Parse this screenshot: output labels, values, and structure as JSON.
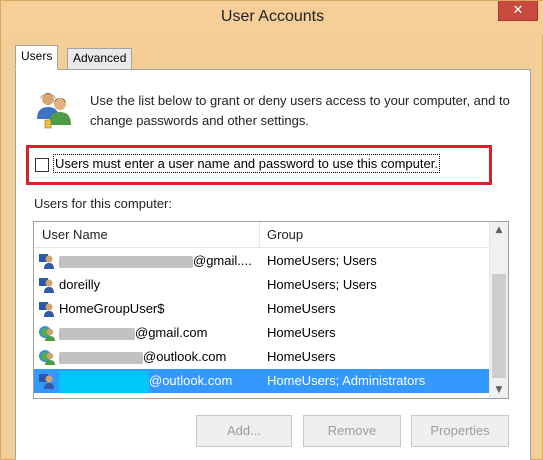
{
  "window": {
    "title": "User Accounts",
    "close_glyph": "✕"
  },
  "tabs": [
    {
      "label": "Users"
    },
    {
      "label": "Advanced"
    }
  ],
  "description": "Use the list below to grant or deny users access to your computer, and to change passwords and other settings.",
  "checkbox": {
    "label": "Users must enter a user name and password to use this computer.",
    "checked": false
  },
  "list": {
    "label": "Users for this computer:",
    "columns": [
      "User Name",
      "Group"
    ],
    "rows": [
      {
        "name_visible": "@gmail....",
        "group": "HomeUsers; Users",
        "icon": "local-user-icon",
        "redacted": true,
        "selected": false
      },
      {
        "name_visible": "doreilly",
        "group": "HomeUsers; Users",
        "icon": "local-user-icon",
        "redacted": false,
        "selected": false
      },
      {
        "name_visible": "HomeGroupUser$",
        "group": "HomeUsers",
        "icon": "local-user-icon",
        "redacted": false,
        "selected": false
      },
      {
        "name_visible": "@gmail.com",
        "group": "HomeUsers",
        "icon": "microsoft-account-icon",
        "redacted": true,
        "selected": false
      },
      {
        "name_visible": "@outlook.com",
        "group": "HomeUsers",
        "icon": "microsoft-account-icon",
        "redacted": true,
        "selected": false
      },
      {
        "name_visible": "@outlook.com",
        "group": "HomeUsers; Administrators",
        "icon": "local-user-icon",
        "redacted": true,
        "selected": true
      }
    ]
  },
  "buttons": {
    "add": "Add...",
    "remove": "Remove",
    "properties": "Properties"
  },
  "colors": {
    "selection": "#3399ff",
    "highlight_border": "#d8222a",
    "close_button": "#c94b3f"
  }
}
